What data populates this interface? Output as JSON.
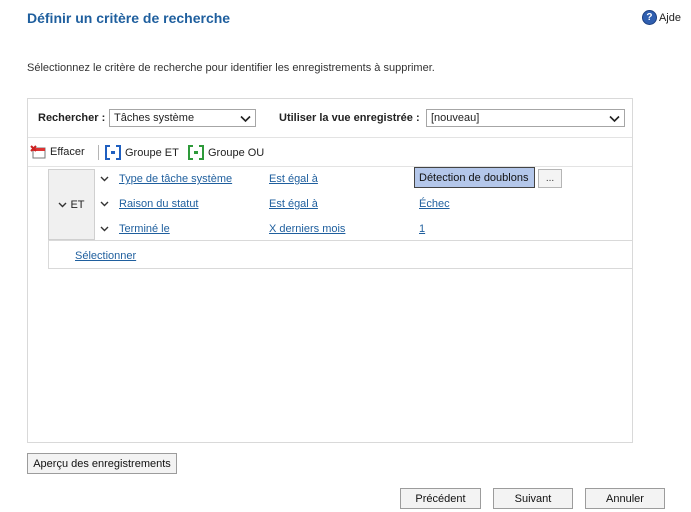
{
  "dialog": {
    "title": "Définir un critère de recherche",
    "help_label": "Ajde",
    "instruction": "Sélectionnez le critère de recherche pour identifier les enregistrements à supprimer."
  },
  "search": {
    "search_label": "Rechercher :",
    "search_value": "Tâches système",
    "saved_view_label": "Utiliser la vue enregistrée :",
    "saved_view_value": "[nouveau]"
  },
  "toolbar": {
    "clear_label": "Effacer",
    "group_and_label": "Groupe ET",
    "group_or_label": "Groupe OU"
  },
  "criteria": {
    "group_label": "ET",
    "rows": [
      {
        "field": "Type de tâche système",
        "operator": "Est égal à",
        "value": "Détection de doublons"
      },
      {
        "field": "Raison du statut",
        "operator": "Est égal à",
        "value": "Échec"
      },
      {
        "field": "Terminé le",
        "operator": "X derniers mois",
        "value": "1"
      }
    ],
    "lookup_button": "...",
    "select_label": "Sélectionner"
  },
  "buttons": {
    "preview": "Aperçu des enregistrements",
    "previous": "Précédent",
    "next": "Suivant",
    "cancel": "Annuler"
  },
  "colors": {
    "title": "#1f5f9e",
    "link": "#1f5f9e",
    "selected_value_bg": "#b4c7ea"
  }
}
